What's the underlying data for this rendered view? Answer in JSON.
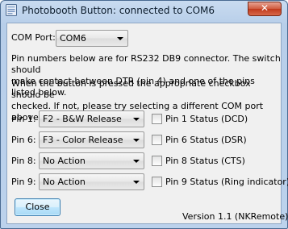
{
  "window": {
    "title": "Photobooth Button: connected to COM6",
    "close_glyph": "✕"
  },
  "com": {
    "label": "COM Port:",
    "selected": "COM6"
  },
  "info": {
    "line1": "Pin numbers below are for RS232 DB9 connector. The switch should",
    "line2": "make contact between DTR (pin 4) and one of the pins listed below.",
    "line3": "When the button is pressed the appropriate checkbox should be",
    "line4": "checked. If not, please try selecting a different COM port above."
  },
  "pins": [
    {
      "label": "Pin 1:",
      "action": "F2 - B&W Release",
      "status": "Pin 1 Status (DCD)",
      "checked": false
    },
    {
      "label": "Pin 6:",
      "action": "F3 - Color Release",
      "status": "Pin 6 Status (DSR)",
      "checked": false
    },
    {
      "label": "Pin 8:",
      "action": "No Action",
      "status": "Pin 8 Status (CTS)",
      "checked": false
    },
    {
      "label": "Pin 9:",
      "action": "No Action",
      "status": "Pin 9 Status (Ring indicator)",
      "checked": false
    }
  ],
  "close_button": {
    "label": "Close"
  },
  "version": "Version 1.1 (NKRemote)",
  "icons": {
    "app": "app-icon",
    "window_close": "close-icon",
    "dropdown": "chevron-down-icon"
  }
}
